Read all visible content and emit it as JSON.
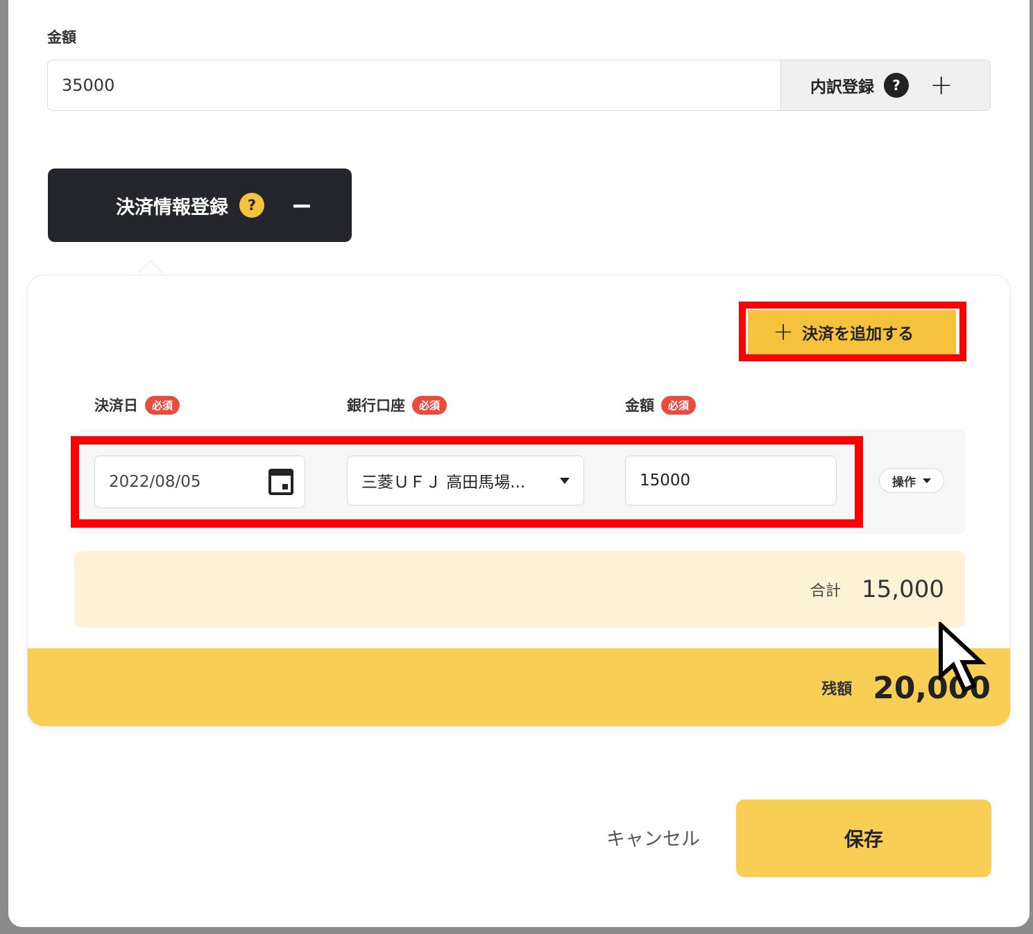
{
  "amount": {
    "label": "金額",
    "value": "35000",
    "breakdown_label": "内訳登録",
    "help_glyph": "?",
    "add_glyph": "+"
  },
  "payment_section": {
    "toggle_label": "決済情報登録",
    "help_glyph": "?",
    "collapse_glyph": "−",
    "add_payment_label": "決済を追加する",
    "add_glyph": "+",
    "columns": [
      {
        "label": "決済日",
        "badge": "必須"
      },
      {
        "label": "銀行口座",
        "badge": "必須"
      },
      {
        "label": "金額",
        "badge": "必須"
      }
    ],
    "row": {
      "date": "2022/08/05",
      "bank": "三菱ＵＦＪ 高田馬場...",
      "amount": "15000",
      "operation_label": "操作"
    },
    "total_label": "合計",
    "total_value": "15,000",
    "remaining_label": "残額",
    "remaining_value": "20,000"
  },
  "footer": {
    "cancel_label": "キャンセル",
    "save_label": "保存"
  },
  "icons": {
    "calendar": "calendar-icon",
    "dropdown": "chevron-down-icon",
    "cursor": "mouse-pointer-icon"
  },
  "colors": {
    "accent_yellow": "#f8cf54",
    "dark": "#24262b",
    "required_badge": "#e94b3c",
    "highlight_red": "#ff0000",
    "total_bg": "#fdf2d6"
  }
}
